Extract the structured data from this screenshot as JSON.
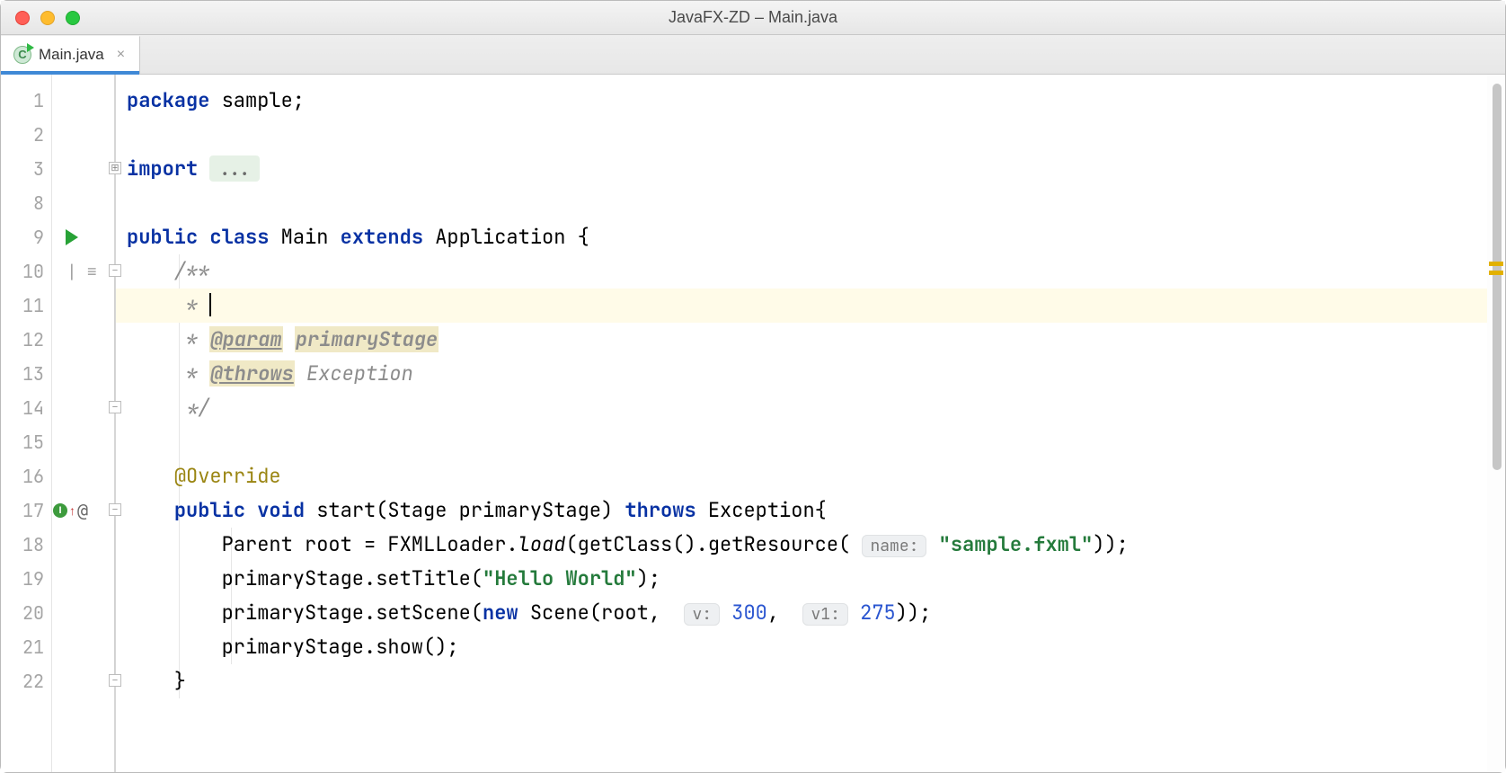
{
  "window": {
    "title": "JavaFX-ZD – Main.java"
  },
  "tab": {
    "icon_letter": "C",
    "label": "Main.java",
    "close_glyph": "×"
  },
  "gutter": {
    "line_numbers": [
      "1",
      "2",
      "3",
      "8",
      "9",
      "10",
      "11",
      "12",
      "13",
      "14",
      "15",
      "16",
      "17",
      "18",
      "19",
      "20",
      "21",
      "22"
    ],
    "fold_expand_glyph": "⊞",
    "fold_minus_glyph": "−",
    "align_glyph": "⎸≡",
    "at_glyph": "@",
    "override_letter": "I",
    "up_arrow": "↑"
  },
  "code": {
    "l1_kw": "package",
    "l1_rest": " sample;",
    "l3_kw": "import",
    "l3_folded": "...",
    "l9_public": "public",
    "l9_class": "class",
    "l9_name": " Main ",
    "l9_extends": "extends",
    "l9_app": " Application {",
    "l10": "    /**",
    "l11": "     * ",
    "l12_pre": "     * ",
    "l12_tag": "@param",
    "l12_space": " ",
    "l12_param": "primaryStage",
    "l13_pre": "     * ",
    "l13_tag": "@throws",
    "l13_space": " ",
    "l13_exc": "Exception",
    "l14": "     */",
    "l16_pre": "    ",
    "l16_anno": "@Override",
    "l17_ind": "    ",
    "l17_public": "public",
    "l17_void": "void",
    "l17_sig": " start(Stage primaryStage) ",
    "l17_throws": "throws",
    "l17_tail": " Exception{",
    "l18_ind": "        ",
    "l18_a": "Parent root = FXMLLoader.",
    "l18_load": "load",
    "l18_b": "(getClass().getResource(",
    "l18_hint": "name:",
    "l18_sp": " ",
    "l18_str": "\"sample.fxml\"",
    "l18_c": "));",
    "l19_ind": "        ",
    "l19_a": "primaryStage.setTitle(",
    "l19_str": "\"Hello World\"",
    "l19_b": ");",
    "l20_ind": "        ",
    "l20_a": "primaryStage.setScene(",
    "l20_new": "new",
    "l20_b": " Scene(root, ",
    "l20_hint1": "v:",
    "l20_sp1": " ",
    "l20_n1": "300",
    "l20_c": ", ",
    "l20_hint2": "v1:",
    "l20_sp2": " ",
    "l20_n2": "275",
    "l20_d": "));",
    "l21_ind": "        ",
    "l21_a": "primaryStage.show();",
    "l22": "    }"
  }
}
